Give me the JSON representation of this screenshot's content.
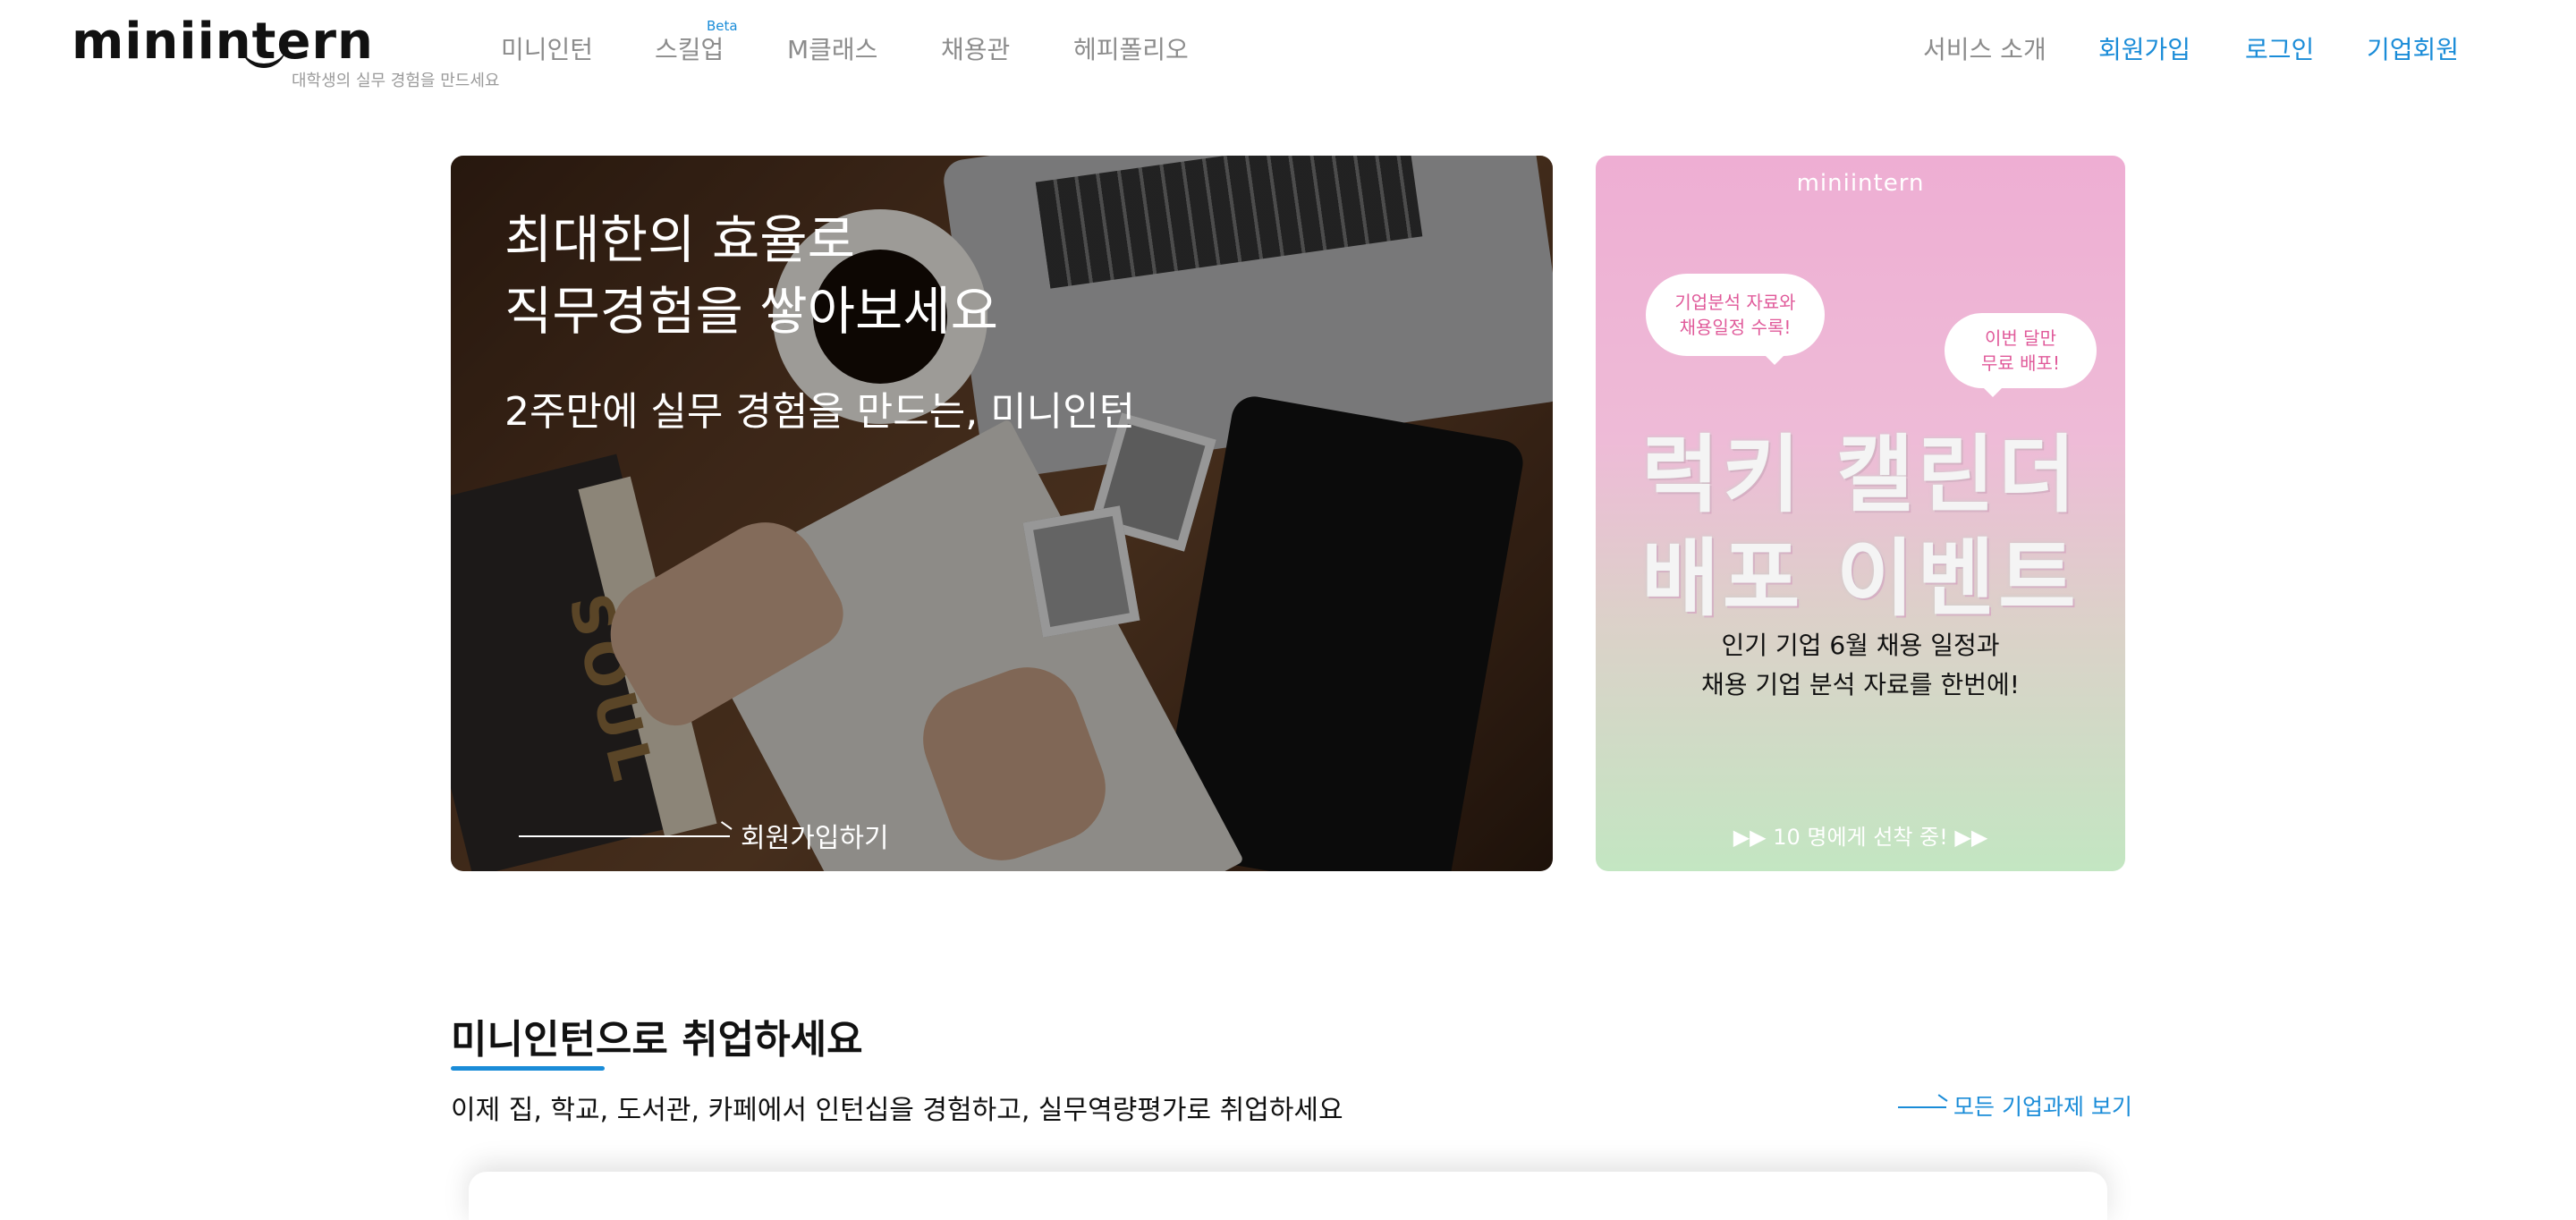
{
  "header": {
    "logo_text": "miniintern",
    "logo_tagline": "대학생의 실무 경험을 만드세요",
    "nav": [
      {
        "label": "미니인턴"
      },
      {
        "label": "스킬업"
      },
      {
        "label": "M클래스"
      },
      {
        "label": "채용관"
      },
      {
        "label": "헤피폴리오"
      }
    ],
    "beta_badge": "Beta",
    "right_nav": [
      {
        "label": "서비스 소개"
      },
      {
        "label": "회원가입"
      },
      {
        "label": "로그인"
      },
      {
        "label": "기업회원"
      }
    ]
  },
  "hero": {
    "title": "최대한의 효율로\n직무경험을 쌓아보세요",
    "subtitle": "2주만에 실무 경험을 만드는, 미니인턴",
    "book_text": "SOUL",
    "cta_label": "회원가입하기"
  },
  "event": {
    "logo_text": "miniintern",
    "bubble_left": "기업분석 자료와\n채용일정 수록!",
    "bubble_right": "이번 달만\n무료 배포!",
    "title": "럭키 캘린더\n배포 이벤트",
    "description": "인기 기업 6월 채용 일정과\n채용 기업 분석 자료를 한번에!",
    "footer": "▶▶ 10 명에게 선착 중! ▶▶"
  },
  "section": {
    "title": "미니인턴으로 취업하세요",
    "subtitle": "이제 집, 학교, 도서관, 카페에서 인턴십을 경험하고, 실무역량평가로 취업하세요",
    "all_link": "모든 기업과제 보기"
  },
  "colors": {
    "accent": "#1a8cd8",
    "nav_gray": "#8c8c8c"
  }
}
